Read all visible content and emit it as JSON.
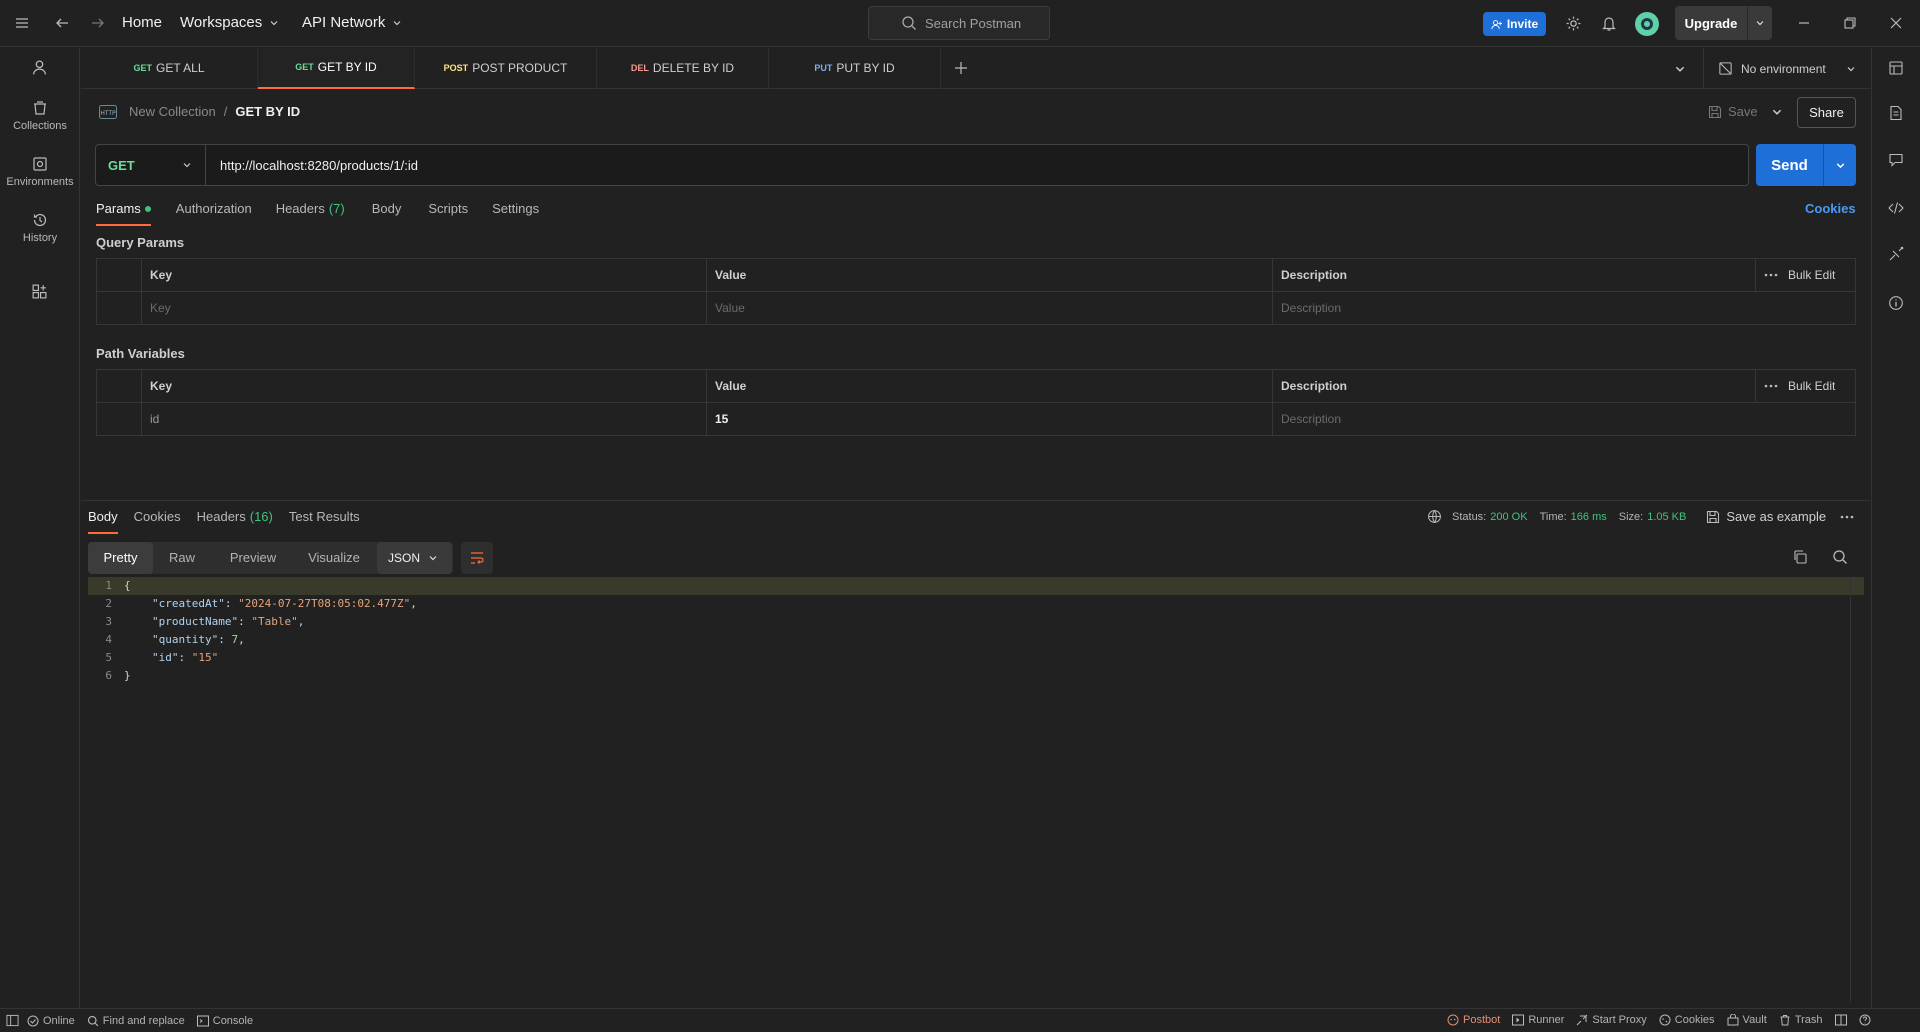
{
  "topbar": {
    "home": "Home",
    "workspaces": "Workspaces",
    "api_network": "API Network",
    "search_placeholder": "Search Postman",
    "invite": "Invite",
    "upgrade": "Upgrade"
  },
  "rail": {
    "items": [
      {
        "label": "Collections",
        "icon": "collections-icon"
      },
      {
        "label": "Environments",
        "icon": "environments-icon"
      },
      {
        "label": "History",
        "icon": "history-icon"
      }
    ]
  },
  "tabs": [
    {
      "method": "GET",
      "name": "GET ALL",
      "color": "#6bdd9a"
    },
    {
      "method": "GET",
      "name": "GET BY ID",
      "color": "#6bdd9a",
      "active": true
    },
    {
      "method": "POST",
      "name": "POST PRODUCT",
      "color": "#ffe47e"
    },
    {
      "method": "DEL",
      "name": "DELETE BY ID",
      "color": "#f79a8e"
    },
    {
      "method": "PUT",
      "name": "PUT BY ID",
      "color": "#74aef6"
    }
  ],
  "environment": "No environment",
  "breadcrumb": {
    "collection": "New Collection",
    "separator": "/",
    "request": "GET BY ID"
  },
  "actions": {
    "save": "Save",
    "share": "Share"
  },
  "request": {
    "method": "GET",
    "url": "http://localhost:8280/products/1/:id",
    "send": "Send"
  },
  "request_tabs": {
    "params": "Params",
    "authorization": "Authorization",
    "headers": "Headers",
    "headers_count": "(7)",
    "body": "Body",
    "scripts": "Scripts",
    "settings": "Settings",
    "cookies": "Cookies"
  },
  "query_params": {
    "title": "Query Params",
    "headers": {
      "key": "Key",
      "value": "Value",
      "description": "Description",
      "bulk": "Bulk Edit"
    },
    "placeholders": {
      "key": "Key",
      "value": "Value",
      "description": "Description"
    }
  },
  "path_variables": {
    "title": "Path Variables",
    "headers": {
      "key": "Key",
      "value": "Value",
      "description": "Description",
      "bulk": "Bulk Edit"
    },
    "row": {
      "key": "id",
      "value": "15",
      "description": "Description"
    }
  },
  "response": {
    "tabs": {
      "body": "Body",
      "cookies": "Cookies",
      "headers": "Headers",
      "headers_count": "(16)",
      "tests": "Test Results"
    },
    "status_label": "Status:",
    "status_value": "200 OK",
    "time_label": "Time:",
    "time_value": "166 ms",
    "size_label": "Size:",
    "size_value": "1.05 KB",
    "save_example": "Save as example",
    "views": {
      "pretty": "Pretty",
      "raw": "Raw",
      "preview": "Preview",
      "visualize": "Visualize"
    },
    "format": "JSON",
    "code_lines": [
      {
        "n": "1",
        "text": "{"
      },
      {
        "n": "2",
        "key": "\"createdAt\"",
        "val": "\"2024-07-27T08:05:02.477Z\"",
        "tail": ","
      },
      {
        "n": "3",
        "key": "\"productName\"",
        "val": "\"Table\"",
        "tail": ","
      },
      {
        "n": "4",
        "key": "\"quantity\"",
        "num": "7",
        "tail": ","
      },
      {
        "n": "5",
        "key": "\"id\"",
        "val": "\"15\"",
        "tail": ""
      },
      {
        "n": "6",
        "text": "}"
      }
    ]
  },
  "statusbar": {
    "online": "Online",
    "find": "Find and replace",
    "console": "Console",
    "postbot": "Postbot",
    "runner": "Runner",
    "proxy": "Start Proxy",
    "cookies": "Cookies",
    "vault": "Vault",
    "trash": "Trash"
  }
}
